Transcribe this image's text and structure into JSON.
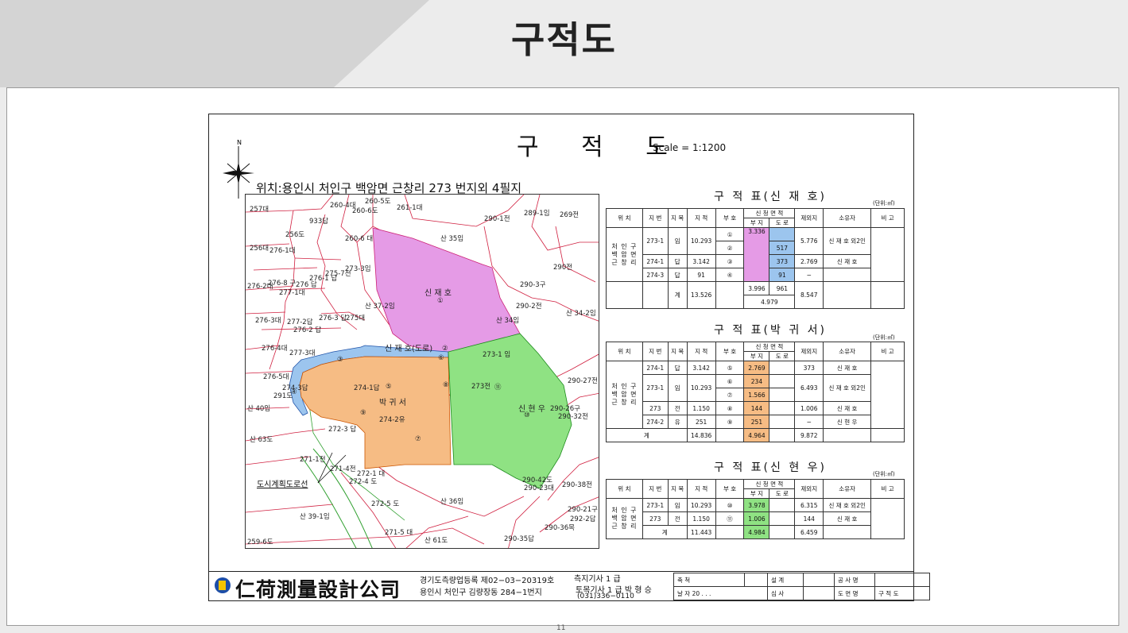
{
  "page_heading": "구적도",
  "sheet": {
    "title": "구 적 도",
    "scale": "Scale = 1:1200",
    "location": "위치:용인시 처인구 백암면 근창리 273 번지외 4필지",
    "compass_label": "N"
  },
  "map": {
    "parcels": [
      "257대",
      "933답",
      "260-4대",
      "260-5도",
      "260-6도",
      "261-1대",
      "290-1전",
      "289-1임",
      "269전",
      "256도",
      "256대",
      "276-1대",
      "260-6 대",
      "산 35임",
      "273-3임",
      "290전",
      "276-2대",
      "276-8 구",
      "276-1 답",
      "276 답",
      "275-7전",
      "277-1대",
      "290-3구",
      "산 37-2임",
      "290-2전",
      "산 34-2임",
      "276-3대",
      "277-2답",
      "276-3 답",
      "275대",
      "276-2 답",
      "산 34임",
      "276-4대",
      "277-3대",
      "273-1 임",
      "276-5대",
      "290-27전",
      "274-3답",
      "274-1답",
      "273전",
      "291도",
      "산 40임",
      "274-2유",
      "290-26구",
      "290-32전",
      "272-3 답",
      "산 63도",
      "271-1전",
      "271-4전",
      "272-1 대",
      "272-4 도",
      "290-42도",
      "290-23대",
      "290-38전",
      "272-5 도",
      "산 36임",
      "290-21구",
      "292-2답",
      "산 39-1임",
      "290-36목",
      "271-5 대",
      "산 61도",
      "290-35답",
      "259-6도"
    ],
    "owner_labels": {
      "shin_jaeho": "신 재 호",
      "shin_jaeho_road": "신 재 호(도로)",
      "park": "박 귀 서",
      "shin_hyunwoo": "신 현 우"
    },
    "numbers": [
      "①",
      "②",
      "③",
      "④",
      "⑤",
      "⑥",
      "⑦",
      "⑧",
      "⑨",
      "⑩",
      "⑪"
    ],
    "leader_label": "도시계획도로선"
  },
  "colors": {
    "pink": "#e59be6",
    "blue": "#9cc5ee",
    "orange": "#f6bc84",
    "green": "#8fe283"
  },
  "unit": "(단위:㎡)",
  "tables": {
    "headers": {
      "loc": "위 치",
      "jibun": "지 번",
      "jimok": "지 목",
      "area": "지 적",
      "sign": "부 호",
      "req": "신 청 면 적",
      "req_a": "부 지",
      "req_b": "도 로",
      "excl": "제외지",
      "owner": "소유자",
      "note": "비 고"
    },
    "location_text": "처 인 구\n백 암 면\n근 창 리",
    "t1": {
      "title": "구 적 표(신 재 호)",
      "rows": [
        {
          "jibun": "273-1",
          "jimok": "임",
          "area": "10.293",
          "sign": "①",
          "a": "3.336",
          "b": "",
          "excl": "5.776",
          "owner": "신 재 호 외2인"
        },
        {
          "jibun": "",
          "jimok": "",
          "area": "",
          "sign": "②",
          "a": "",
          "b": "517",
          "excl": "",
          "owner": ""
        },
        {
          "jibun": "274-1",
          "jimok": "답",
          "area": "3.142",
          "sign": "③",
          "a": "",
          "b": "373",
          "excl": "2.769",
          "owner": "신 재 호"
        },
        {
          "jibun": "274-3",
          "jimok": "답",
          "area": "91",
          "sign": "④",
          "a": "",
          "b": "91",
          "excl": "−",
          "owner": ""
        }
      ],
      "total_label": "계",
      "total_area": "13.526",
      "total_a": "3.996",
      "total_b": "961",
      "total_sum": "4.979",
      "total_excl": "8.547"
    },
    "t2": {
      "title": "구 적 표(박 귀 서)",
      "rows": [
        {
          "jibun": "274-1",
          "jimok": "답",
          "area": "3.142",
          "sign": "⑤",
          "a": "2.769",
          "excl": "373",
          "owner": "신 재 호"
        },
        {
          "jibun": "273-1",
          "jimok": "임",
          "area": "10.293",
          "sign": "⑥",
          "a": "234",
          "excl": "6.493",
          "owner": "신 재 호 외2인"
        },
        {
          "jibun": "",
          "jimok": "",
          "area": "",
          "sign": "⑦",
          "a": "1.566",
          "excl": "",
          "owner": ""
        },
        {
          "jibun": "273",
          "jimok": "전",
          "area": "1.150",
          "sign": "⑧",
          "a": "144",
          "excl": "1.006",
          "owner": "신 재 호"
        },
        {
          "jibun": "274-2",
          "jimok": "유",
          "area": "251",
          "sign": "⑨",
          "a": "251",
          "excl": "−",
          "owner": "신 현 우"
        }
      ],
      "total_label": "계",
      "total_area": "14.836",
      "total_a": "4.964",
      "total_excl": "9.872"
    },
    "t3": {
      "title": "구 적 표(신 현 우)",
      "rows": [
        {
          "jibun": "273-1",
          "jimok": "임",
          "area": "10.293",
          "sign": "⑩",
          "a": "3.978",
          "excl": "6.315",
          "owner": "신 재 호 외2인"
        },
        {
          "jibun": "273",
          "jimok": "전",
          "area": "1.150",
          "sign": "⑪",
          "a": "1.006",
          "excl": "144",
          "owner": "신 재 호"
        }
      ],
      "total_label": "계",
      "total_area": "11.443",
      "total_a": "4.984",
      "total_excl": "6.459"
    }
  },
  "title_block": {
    "company": "仁荷測量設計公司",
    "reg1": "경기도측량업등록 제02−03−20319호",
    "reg2": "용인시 처인구 김량장동 284−1번지",
    "license1": "측지기사 1 급",
    "license2": "토목기사 1 급  박 형 승",
    "phone": "(031)336−0110",
    "scale_label": "축 척",
    "date_label": "날 자  20 .   .   .",
    "design": "설 계",
    "check": "심 사",
    "project": "공 사 명",
    "drawing": "도 면 명",
    "drawing_value": "구 적 도"
  },
  "page_number": "11"
}
